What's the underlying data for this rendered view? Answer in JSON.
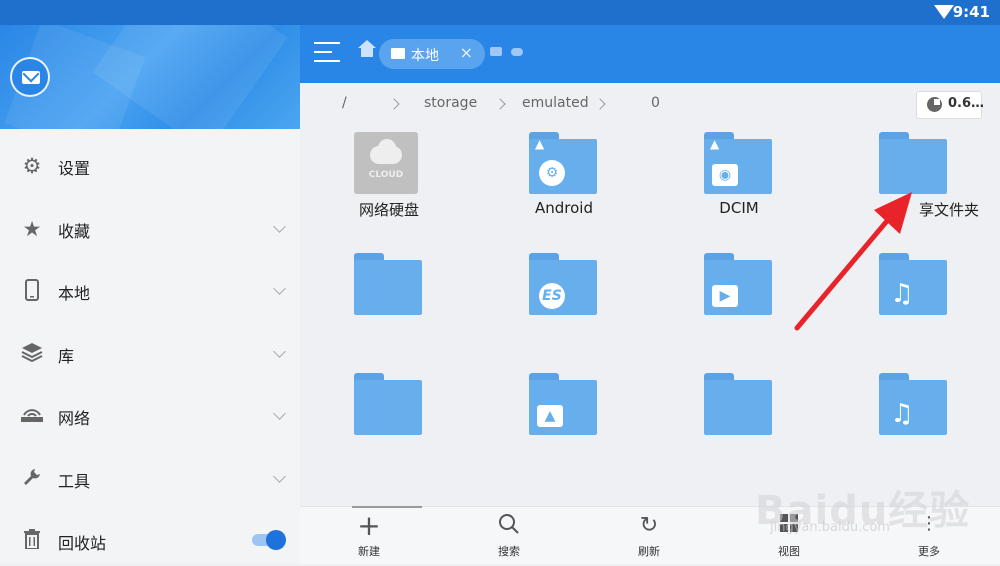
{
  "status_bar": {
    "time": "9:41"
  },
  "drawer": {
    "items": [
      {
        "label": "设置",
        "icon": "gear-icon"
      },
      {
        "label": "收藏",
        "icon": "star-icon"
      },
      {
        "label": "本地",
        "icon": "phone-icon"
      },
      {
        "label": "库",
        "icon": "layers-icon"
      },
      {
        "label": "网络",
        "icon": "network-icon"
      },
      {
        "label": "工具",
        "icon": "wrench-icon"
      },
      {
        "label": "回收站",
        "icon": "trash-icon",
        "toggle_on": true
      }
    ]
  },
  "toolbar": {
    "tab_label": "本地"
  },
  "path": {
    "root": "/",
    "segments": [
      "storage",
      "emulated",
      "0"
    ],
    "usage": "0.6…"
  },
  "files": [
    {
      "name": "网络硬盘",
      "kind": "cloud",
      "cloud_text": "CLOUD"
    },
    {
      "name": "Android",
      "kind": "folder",
      "emblem": "gear"
    },
    {
      "name": "DCIM",
      "kind": "folder",
      "emblem": "camera"
    },
    {
      "name": "享文件夹",
      "kind": "folder",
      "emblem": ""
    },
    {
      "name": "",
      "kind": "folder",
      "emblem": ""
    },
    {
      "name": "",
      "kind": "folder",
      "emblem": "es"
    },
    {
      "name": "",
      "kind": "folder",
      "emblem": "video"
    },
    {
      "name": "",
      "kind": "folder",
      "emblem": "music"
    },
    {
      "name": "",
      "kind": "folder",
      "emblem": ""
    },
    {
      "name": "",
      "kind": "folder",
      "emblem": "picture"
    },
    {
      "name": "",
      "kind": "folder",
      "emblem": ""
    },
    {
      "name": "",
      "kind": "folder",
      "emblem": "music"
    }
  ],
  "bottom_bar": {
    "new": "新建",
    "search": "搜索",
    "refresh": "刷新",
    "view": "视图",
    "more": "更多"
  },
  "watermark": {
    "brand": "Baidu经验",
    "url": "jingyan.baidu.com"
  },
  "colors": {
    "accent": "#2a86e6",
    "folder": "#66afec",
    "arrow": "#e8242a"
  }
}
